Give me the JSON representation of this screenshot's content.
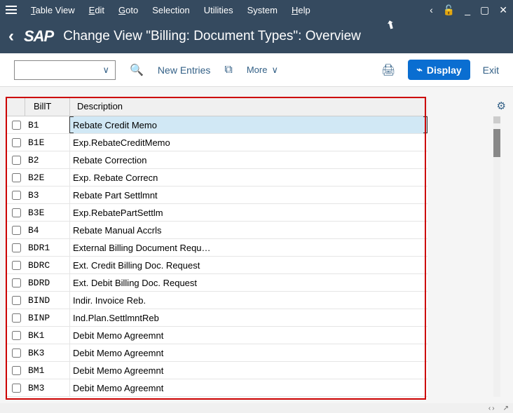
{
  "menu": {
    "table_view": "Table View",
    "edit": "Edit",
    "goto": "Goto",
    "selection": "Selection",
    "utilities": "Utilities",
    "system": "System",
    "help": "Help"
  },
  "header": {
    "logo": "SAP",
    "title": "Change View \"Billing: Document Types\": Overview"
  },
  "toolbar": {
    "new_entries": "New Entries",
    "more": "More",
    "display": "Display",
    "exit": "Exit"
  },
  "table": {
    "col_billt": "BillT",
    "col_desc": "Description",
    "rows": [
      {
        "billt": "B1",
        "desc": "Rebate Credit Memo",
        "selected": true
      },
      {
        "billt": "B1E",
        "desc": "Exp.RebateCreditMemo"
      },
      {
        "billt": "B2",
        "desc": "Rebate Correction"
      },
      {
        "billt": "B2E",
        "desc": "Exp. Rebate Correcn"
      },
      {
        "billt": "B3",
        "desc": "Rebate Part Settlmnt"
      },
      {
        "billt": "B3E",
        "desc": "Exp.RebatePartSettlm"
      },
      {
        "billt": "B4",
        "desc": "Rebate Manual Accrls"
      },
      {
        "billt": "BDR1",
        "desc": "External Billing Document Requ…"
      },
      {
        "billt": "BDRC",
        "desc": "Ext. Credit Billing Doc. Request"
      },
      {
        "billt": "BDRD",
        "desc": "Ext. Debit Billing Doc. Request"
      },
      {
        "billt": "BIND",
        "desc": "Indir. Invoice Reb."
      },
      {
        "billt": "BINP",
        "desc": "Ind.Plan.SettlmntReb"
      },
      {
        "billt": "BK1",
        "desc": "Debit Memo Agreemnt"
      },
      {
        "billt": "BK3",
        "desc": "Debit Memo Agreemnt"
      },
      {
        "billt": "BM1",
        "desc": "Debit Memo Agreemnt"
      },
      {
        "billt": "BM3",
        "desc": "Debit Memo Agreemnt"
      }
    ]
  }
}
